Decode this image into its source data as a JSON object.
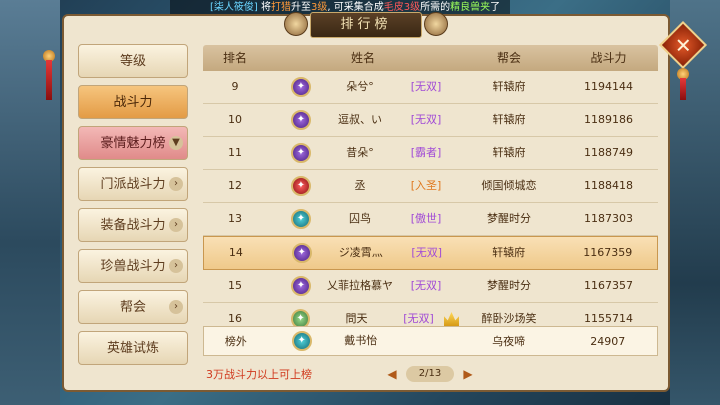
{
  "ticker": {
    "player": "[柒人筱俊]",
    "t1": " 将",
    "item": "打猎",
    "t2": "升至",
    "lvl": "3级",
    "t3": ", 可采集合成",
    "mat": "毛皮3级",
    "t4": "所需的",
    "beast": "精良兽夹",
    "t5": "了"
  },
  "title": "排行榜",
  "tabs": [
    {
      "label": "等级"
    },
    {
      "label": "战斗力"
    },
    {
      "label": "豪情魅力榜"
    },
    {
      "label": "门派战斗力"
    },
    {
      "label": "装备战斗力"
    },
    {
      "label": "珍兽战斗力"
    },
    {
      "label": "帮会"
    },
    {
      "label": "英雄试炼"
    }
  ],
  "headers": {
    "rank": "排名",
    "name": "姓名",
    "guild": "帮会",
    "power": "战斗力"
  },
  "rows": [
    {
      "rank": "9",
      "name": "朵兮°",
      "title": "[无双]",
      "guild": "轩辕府",
      "power": "1194144"
    },
    {
      "rank": "10",
      "name": "逗叔、い",
      "title": "[无双]",
      "guild": "轩辕府",
      "power": "1189186"
    },
    {
      "rank": "11",
      "name": "昔朵°",
      "title": "[霸者]",
      "guild": "轩辕府",
      "power": "1188749"
    },
    {
      "rank": "12",
      "name": "丞",
      "title": "[入圣]",
      "guild": "倾国倾城恋",
      "power": "1188418"
    },
    {
      "rank": "13",
      "name": "囚鸟",
      "title": "[傲世]",
      "guild": "梦醒时分",
      "power": "1187303"
    },
    {
      "rank": "14",
      "name": "ジ凌霄灬",
      "title": "[无双]",
      "guild": "轩辕府",
      "power": "1167359"
    },
    {
      "rank": "15",
      "name": "乂菲拉格慕ヤ",
      "title": "[无双]",
      "guild": "梦醒时分",
      "power": "1167357"
    },
    {
      "rank": "16",
      "name": "問天",
      "title": "[无双]",
      "guild": "醉卧沙场笑",
      "power": "1155714"
    }
  ],
  "outside": {
    "rank": "榜外",
    "name": "戴书怡",
    "guild": "乌夜啼",
    "power": "24907"
  },
  "footer_note": "3万战斗力以上可上榜",
  "pager": {
    "page": "2/13"
  },
  "colors": {
    "accent": "#e39b45",
    "highlight_row": "#efc98a",
    "note": "#d0391d"
  }
}
